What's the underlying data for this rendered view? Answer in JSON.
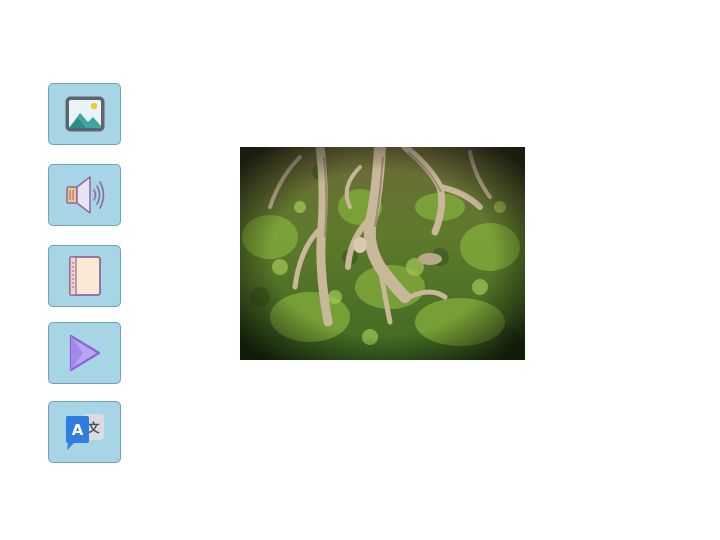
{
  "toolbar": {
    "buttons": [
      {
        "name": "image-button",
        "icon": "image-icon"
      },
      {
        "name": "audio-button",
        "icon": "speaker-icon"
      },
      {
        "name": "notebook-button",
        "icon": "notebook-icon"
      },
      {
        "name": "play-button",
        "icon": "play-icon"
      },
      {
        "name": "translate-button",
        "icon": "translate-icon",
        "glyphs": [
          "A",
          "文"
        ]
      }
    ]
  },
  "main": {
    "photo": {
      "subject": "tree-roots-photo"
    }
  },
  "colors": {
    "button_bg": "#a7d5e6",
    "button_border": "#6fa3b8",
    "play_fill": "#b9a6f0",
    "play_stroke": "#8a63d8",
    "translate_blue": "#2f7de1",
    "translate_gray": "#d9dbe0"
  }
}
